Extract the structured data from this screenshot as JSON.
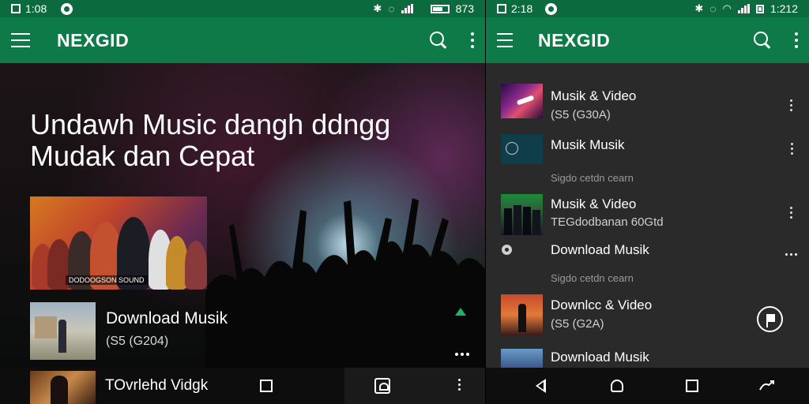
{
  "left": {
    "status": {
      "time": "1:08",
      "battery": "873"
    },
    "appbar": {
      "brand": "NEXGID",
      "menu_icon": "menu-icon",
      "search_icon": "search-icon",
      "more_icon": "more-vert-icon"
    },
    "hero": {
      "title_line1": "Undawh Music dangh ddngg",
      "title_line2": "Mudak dan Cepat",
      "feature_caption": "DODOOGSON SOUND"
    },
    "rows": [
      {
        "title": "Download Musik",
        "subtitle": "(S5 (G204)"
      },
      {
        "title": "TOvrlehd Vidgk"
      }
    ],
    "colors": {
      "statusbar": "#0b6b3e",
      "appbar": "#0e7a47",
      "accent": "#1bb374"
    }
  },
  "right": {
    "status": {
      "time": "2:18",
      "battery": "1:212"
    },
    "appbar": {
      "brand": "NEXGID",
      "menu_icon": "menu-icon",
      "search_icon": "search-icon",
      "more_icon": "more-vert-icon"
    },
    "items": [
      {
        "title": "Musik & Video",
        "subtitle": "(S5 (G30A)"
      },
      {
        "title": "Musik Musik"
      },
      {
        "meta": "Sigdo cetdn cearn"
      },
      {
        "title": "Musik & Video",
        "subtitle": "TEGdodbanan 60Gtd"
      },
      {
        "title": "Download Musik"
      },
      {
        "meta": "Sigdo cetdn cearn"
      },
      {
        "title": "Downlcc & Video",
        "subtitle": "(S5 (G2A)"
      },
      {
        "title": "Download Musik"
      }
    ]
  }
}
